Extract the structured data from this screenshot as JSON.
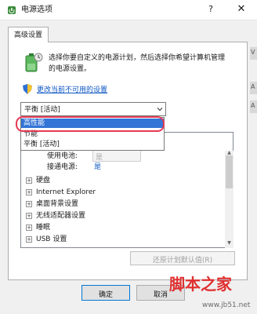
{
  "window": {
    "title": "电源选项",
    "help_label": "?",
    "close_label": "✕"
  },
  "tab": {
    "label": "高级设置"
  },
  "description": {
    "line1": "选择你要自定义的电源计划，然后选择你希望计算机管理",
    "line2": "的电源设置。"
  },
  "change_link": "更改当前不可用的设置",
  "plan_combo": {
    "selected": "平衡 [活动]",
    "options": [
      "高性能",
      "节能",
      "平衡 [活动]"
    ],
    "highlighted": "高性能"
  },
  "settings_tree": {
    "on_battery_label": "使用电池:",
    "on_battery_value": "是",
    "plugged_in_label": "接通电源:",
    "plugged_in_value": "是",
    "items": [
      "硬盘",
      "Internet Explorer",
      "桌面背景设置",
      "无线适配器设置",
      "睡眠",
      "USB 设置"
    ]
  },
  "buttons": {
    "restore": "还原计划默认值(R)",
    "ok": "确定",
    "cancel": "取消"
  },
  "right_strip": {
    "a": "V",
    "b": "A",
    "c": "A"
  },
  "watermark": {
    "text": "脚本之家",
    "url": "www.jb51.net"
  },
  "colors": {
    "link": "#0b55c2",
    "selection": "#3375d6",
    "annotation": "#e53a55",
    "watermark": "#e03030"
  }
}
